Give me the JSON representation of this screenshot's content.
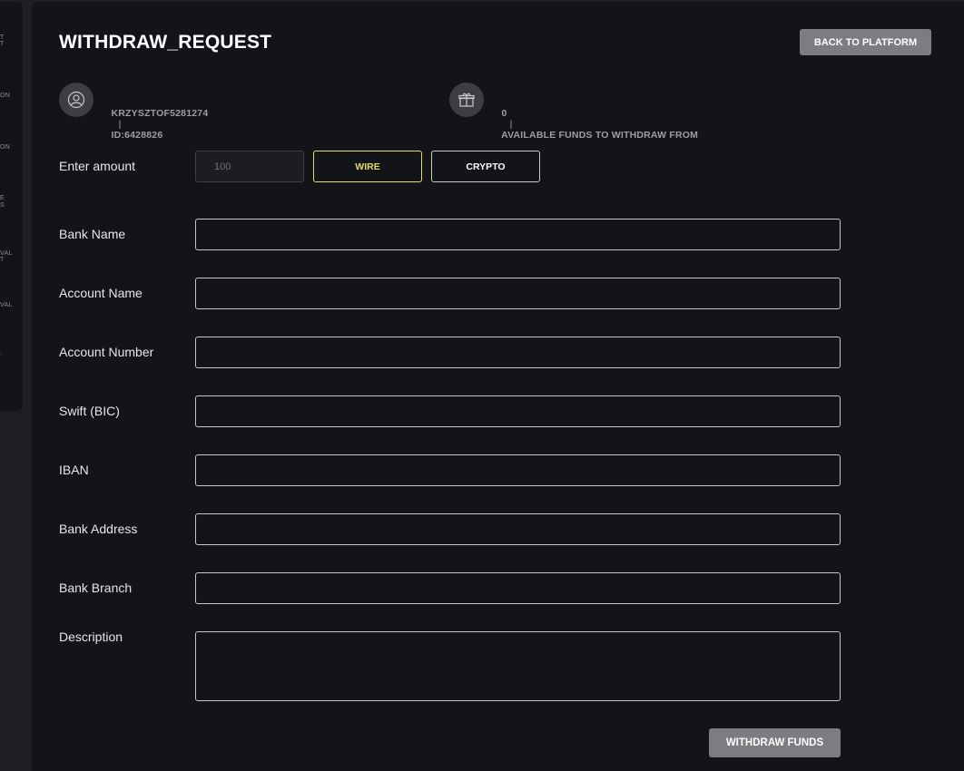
{
  "sidebar": {
    "fragments": [
      "T",
      "T",
      "ON",
      "ON",
      "E",
      "S",
      "VAL",
      "T",
      "VAL",
      "."
    ]
  },
  "page": {
    "title": "WITHDRAW_REQUEST",
    "back_button": "BACK TO PLATFORM"
  },
  "user": {
    "username": "KRZYSZTOF5281274",
    "separator": "|",
    "id_text": "ID:6428826"
  },
  "funds": {
    "amount": "0",
    "separator": "|",
    "label": "AVAILABLE FUNDS TO WITHDRAW FROM"
  },
  "amount_row": {
    "label": "Enter amount",
    "placeholder": "100",
    "methods": [
      "WIRE",
      "CRYPTO"
    ],
    "selected_method": "WIRE"
  },
  "fields": {
    "bank_name": "Bank Name",
    "account_name": "Account Name",
    "account_number": "Account Number",
    "swift": "Swift (BIC)",
    "iban": "IBAN",
    "bank_address": "Bank Address",
    "bank_branch": "Bank Branch",
    "description": "Description"
  },
  "submit_button": "WITHDRAW FUNDS",
  "colors": {
    "background": "#121418",
    "accent_selected": "#e8d873",
    "button_gray": "#7b7d80"
  },
  "icons": {
    "user": "user-icon",
    "gift": "gift-icon"
  }
}
